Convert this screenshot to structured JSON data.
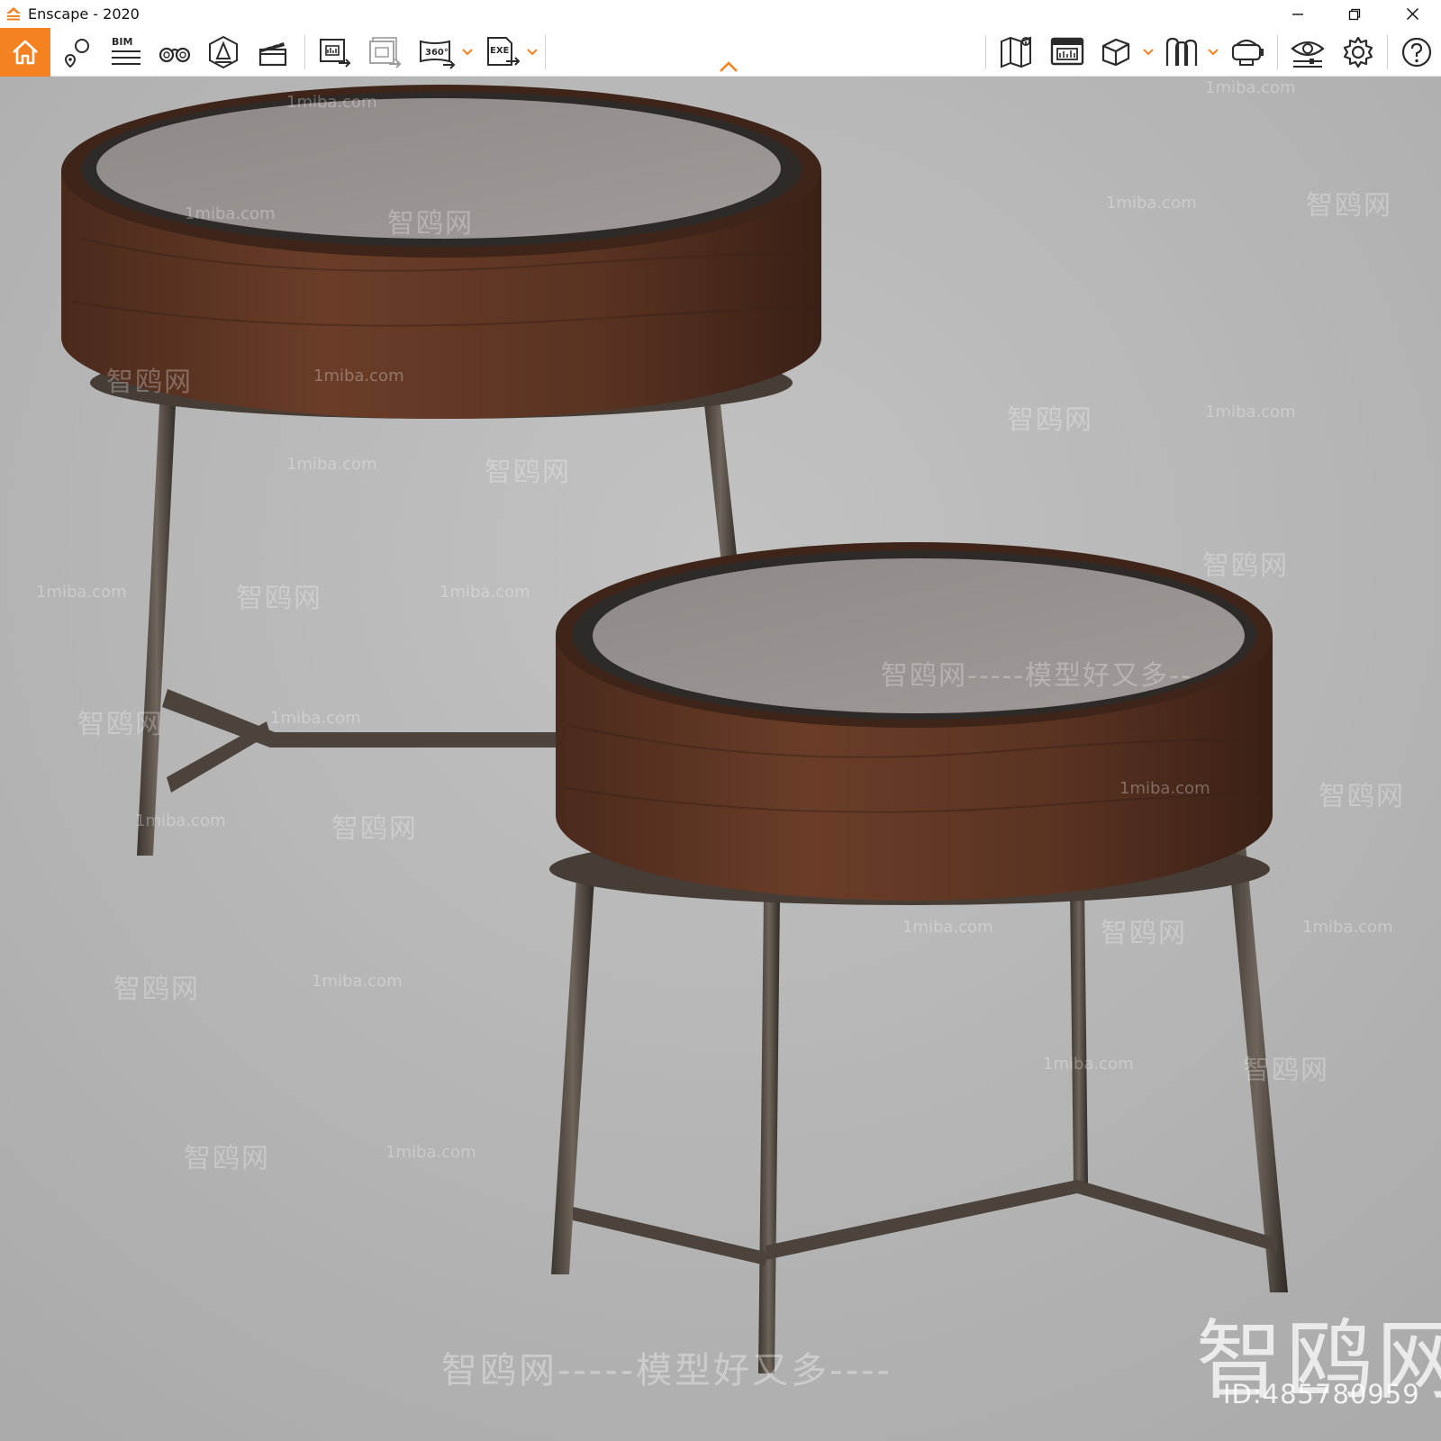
{
  "window": {
    "title": "Enscape - 2020",
    "controls": {
      "minimize": "minimize-icon",
      "maximize": "restore-icon",
      "close": "close-icon"
    }
  },
  "theme": {
    "accent": "#f58220",
    "icon_color": "#2b2b2b",
    "viewport_bg": "#b9b9b9"
  },
  "toolbar": {
    "left_group": [
      {
        "name": "home",
        "icon": "home-icon"
      },
      {
        "name": "views",
        "icon": "views-icon"
      },
      {
        "name": "bim",
        "icon": "bim-icon",
        "label": "BIM"
      },
      {
        "name": "binoculars",
        "icon": "binoculars-icon"
      },
      {
        "name": "atmosphere",
        "icon": "atmosphere-icon"
      },
      {
        "name": "video-editor",
        "icon": "clapper-icon"
      }
    ],
    "export_group": [
      {
        "name": "render-image",
        "icon": "render-image-icon"
      },
      {
        "name": "batch-render",
        "icon": "batch-render-icon"
      },
      {
        "name": "panorama",
        "icon": "panorama-icon",
        "label": "360°",
        "has_dropdown": true
      },
      {
        "name": "export-exe",
        "icon": "exe-export-icon",
        "label": "EXE",
        "has_dropdown": true
      }
    ],
    "right_group": [
      {
        "name": "map",
        "icon": "map-icon"
      },
      {
        "name": "asset-library",
        "icon": "asset-library-icon"
      },
      {
        "name": "material-editor",
        "icon": "cube-icon",
        "has_dropdown": true
      },
      {
        "name": "composite",
        "icon": "composite-icon",
        "has_dropdown": true
      },
      {
        "name": "vr-headset",
        "icon": "vr-headset-icon"
      },
      {
        "name": "visual-settings",
        "icon": "eye-settings-icon"
      },
      {
        "name": "settings",
        "icon": "gear-icon"
      },
      {
        "name": "help",
        "icon": "help-icon"
      }
    ]
  },
  "watermarks": {
    "site": "1miba.com",
    "brand": "智鸥网",
    "dash": "-----",
    "slogan": "智鸥网-----模型好又多----",
    "slogan_mid": "智鸥网-----模型好又多--",
    "big_logo": "智鸥网",
    "id": "ID:485780959"
  }
}
